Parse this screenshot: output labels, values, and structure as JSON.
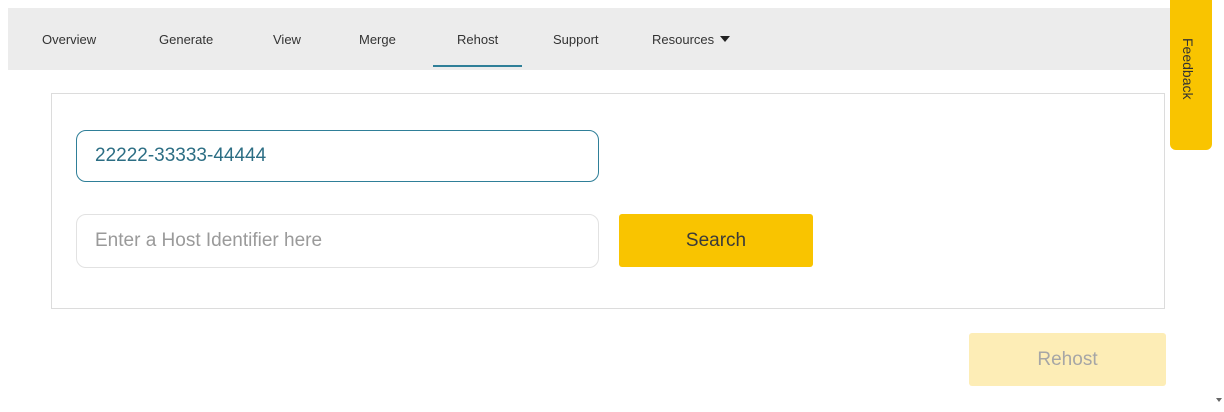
{
  "nav": {
    "items": [
      {
        "label": "Overview"
      },
      {
        "label": "Generate"
      },
      {
        "label": "View"
      },
      {
        "label": "Merge"
      },
      {
        "label": "Rehost"
      },
      {
        "label": "Support"
      },
      {
        "label": "Resources"
      }
    ],
    "active": "Rehost",
    "resources_icon": "caret-down-icon"
  },
  "feedback": {
    "label": "Feedback"
  },
  "form": {
    "code_value": "22222-33333-44444",
    "host_placeholder": "Enter a Host Identifier here",
    "search_label": "Search"
  },
  "rehost_label": "Rehost",
  "colors": {
    "accent_yellow": "#f9c400",
    "accent_teal": "#2f7f98",
    "disabled_yellow": "#fdedb6"
  }
}
